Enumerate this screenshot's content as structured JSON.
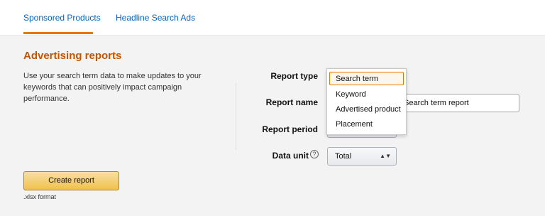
{
  "tabs": [
    {
      "label": "Sponsored Products",
      "active": true
    },
    {
      "label": "Headline Search Ads",
      "active": false
    }
  ],
  "report": {
    "title": "Advertising reports",
    "description": "Use your search term data to make updates to your keywords that can positively impact campaign performance.",
    "fields": {
      "type_label": "Report type",
      "name_label": "Report name",
      "period_label": "Report period",
      "unit_label": "Data unit",
      "name_value": "Search term report",
      "unit_value": "Total"
    },
    "type_dropdown": {
      "options": [
        "Search term",
        "Keyword",
        "Advertised product",
        "Placement"
      ],
      "selected": "Search term"
    },
    "create_button": "Create report",
    "format_note": ".xlsx format"
  },
  "icons": {
    "help": "question-circle-icon",
    "caret": "up-down-caret-icon"
  },
  "colors": {
    "accent_orange": "#e47911",
    "title_orange": "#c45500",
    "link_blue": "#0066c0",
    "button_yellow": "#f0c14b",
    "panel_bg": "#f3f3f3"
  }
}
